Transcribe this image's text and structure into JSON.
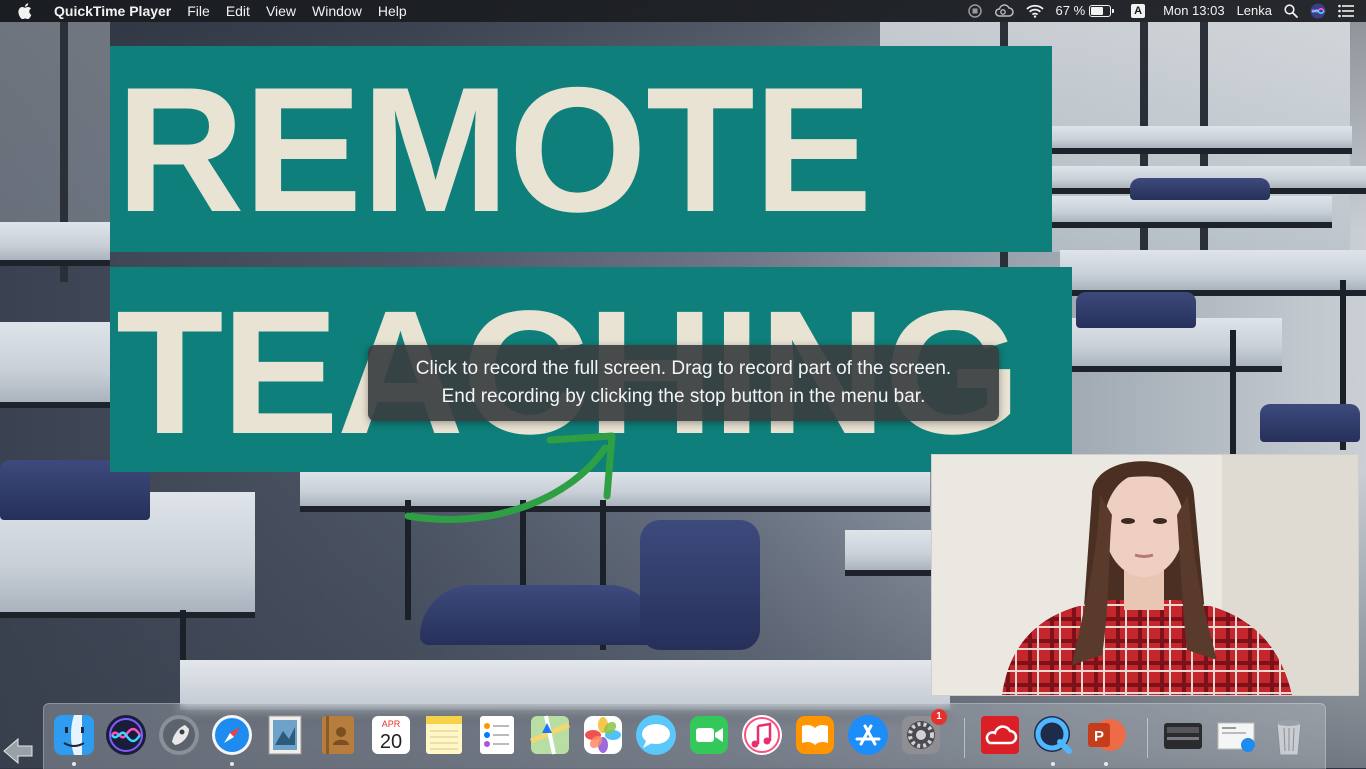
{
  "menubar": {
    "app_name": "QuickTime Player",
    "menus": [
      "File",
      "Edit",
      "View",
      "Window",
      "Help"
    ],
    "status": {
      "battery_percent": "67 %",
      "input_source": "A",
      "clock": "Mon 13:03",
      "user": "Lenka"
    },
    "icons": [
      "apple-icon",
      "stop-recording-icon",
      "creative-cloud-icon",
      "wifi-icon",
      "battery-icon",
      "input-source-icon",
      "spotlight-icon",
      "siri-icon",
      "notification-center-icon"
    ]
  },
  "wallpaper": {
    "line1": "REMOTE",
    "line2": "TEACHING",
    "banner_color": "#0e7f7a",
    "text_color": "#e9e3d4"
  },
  "screen_recording_hint": {
    "line1": "Click to record the full screen. Drag to record part of the screen.",
    "line2": "End recording by clicking the stop button in the menu bar.",
    "arrow_color": "#2ea043"
  },
  "camera_preview": {
    "subject": "woman-in-red-plaid-shirt"
  },
  "dock": {
    "items": [
      {
        "name": "finder",
        "running": true
      },
      {
        "name": "siri",
        "running": false
      },
      {
        "name": "launchpad",
        "running": false
      },
      {
        "name": "safari",
        "running": true
      },
      {
        "name": "mail",
        "running": false
      },
      {
        "name": "contacts",
        "running": false
      },
      {
        "name": "calendar",
        "running": false,
        "month": "APR",
        "day": "20"
      },
      {
        "name": "notes",
        "running": false
      },
      {
        "name": "reminders",
        "running": false
      },
      {
        "name": "maps",
        "running": false
      },
      {
        "name": "photos",
        "running": false
      },
      {
        "name": "messages",
        "running": false
      },
      {
        "name": "facetime",
        "running": false
      },
      {
        "name": "itunes",
        "running": false
      },
      {
        "name": "books",
        "running": false
      },
      {
        "name": "app-store",
        "running": false
      },
      {
        "name": "system-preferences",
        "running": false,
        "badge": "1"
      },
      {
        "name": "creative-cloud",
        "running": false
      },
      {
        "name": "quicktime-player",
        "running": true
      },
      {
        "name": "powerpoint",
        "running": true
      },
      {
        "name": "scanner",
        "running": false
      },
      {
        "name": "downloads-stack",
        "running": false
      },
      {
        "name": "trash",
        "running": false
      }
    ]
  }
}
